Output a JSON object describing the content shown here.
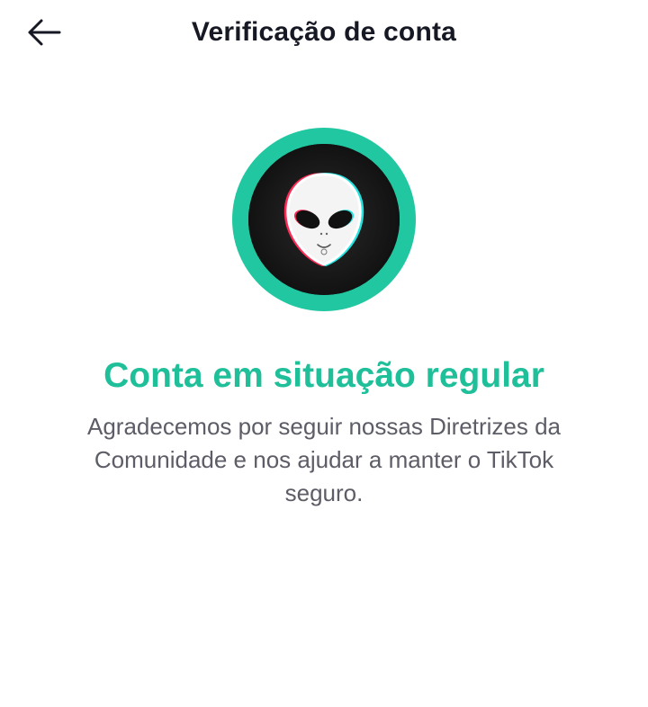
{
  "header": {
    "title": "Verificação de conta",
    "back_icon": "arrow-left-icon"
  },
  "status": {
    "heading": "Conta em situação regular",
    "description": "Agradecemos por seguir nossas Diretrizes da Comunidade e nos ajudar a manter o TikTok seguro."
  },
  "avatar": {
    "icon": "alien-face-icon"
  },
  "colors": {
    "accent": "#1fbf9a",
    "ring": "#20c7a0",
    "text_primary": "#161823",
    "text_secondary": "#5c5d66"
  }
}
